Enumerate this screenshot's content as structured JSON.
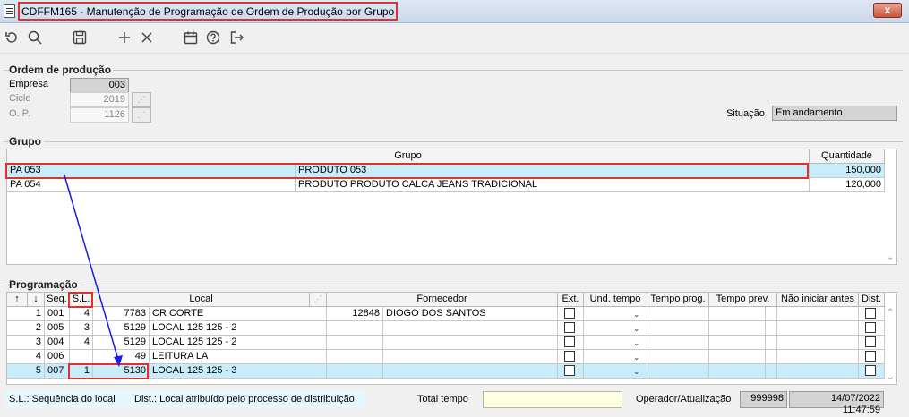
{
  "window": {
    "title": "CDFFM165 - Manutenção de Programação de Ordem de Produção por Grupo",
    "close_glyph": "x"
  },
  "toolbar": {
    "undo": "undo-icon",
    "search": "search-icon",
    "save": "save-icon",
    "add": "add-icon",
    "delete": "delete-icon",
    "calendar": "calendar-icon",
    "help": "help-icon",
    "exit": "exit-icon"
  },
  "ordem": {
    "title": "Ordem de produção",
    "empresa_label": "Empresa",
    "empresa": "003",
    "ciclo_label": "Ciclo",
    "ciclo": "2019",
    "op_label": "O. P.",
    "op": "1126",
    "situacao_label": "Situação",
    "situacao": "Em andamento"
  },
  "grupo": {
    "title": "Grupo",
    "columns": [
      "Grupo",
      "Quantidade"
    ],
    "rows": [
      {
        "code": "PA 053",
        "name": "PRODUTO 053",
        "qty": "150,000"
      },
      {
        "code": "PA 054",
        "name": "PRODUTO PRODUTO CALCA JEANS TRADICIONAL",
        "qty": "120,000"
      }
    ]
  },
  "programacao": {
    "title": "Programação",
    "columns": {
      "up": "↑",
      "down": "↓",
      "seq": "Seq.",
      "sl": "S.L.",
      "local": "Local",
      "fornecedor": "Fornecedor",
      "ext": "Ext.",
      "und": "Und. tempo",
      "prog": "Tempo prog.",
      "prev": "Tempo prev.",
      "nao": "Não iniciar antes",
      "dist": "Dist."
    },
    "rows": [
      {
        "n": "1",
        "seq": "001",
        "sl": "4",
        "lcode": "7783",
        "lname": "CR CORTE",
        "fcode": "12848",
        "fname": "DIOGO DOS SANTOS"
      },
      {
        "n": "2",
        "seq": "005",
        "sl": "3",
        "lcode": "5129",
        "lname": "LOCAL 125 125 - 2",
        "fcode": "",
        "fname": ""
      },
      {
        "n": "3",
        "seq": "004",
        "sl": "4",
        "lcode": "5129",
        "lname": "LOCAL 125 125 - 2",
        "fcode": "",
        "fname": ""
      },
      {
        "n": "4",
        "seq": "006",
        "sl": "",
        "lcode": "49",
        "lname": "LEITURA LA",
        "fcode": "",
        "fname": ""
      },
      {
        "n": "5",
        "seq": "007",
        "sl": "1",
        "lcode": "5130",
        "lname": "LOCAL 125 125 - 3",
        "fcode": "",
        "fname": ""
      }
    ]
  },
  "footer": {
    "legend_sl": "S.L.: Sequência do local",
    "legend_dist": "Dist.: Local atribuído pelo processo de distribuição",
    "total_label": "Total tempo",
    "total_value": "",
    "operador_label": "Operador/Atualização",
    "operador": "999998",
    "datetime": "14/07/2022 11:47:59"
  },
  "colors": {
    "selected_row": "#c8ecf9",
    "annotation_red": "#e03030",
    "annotation_arrow": "#1a1ae6"
  }
}
